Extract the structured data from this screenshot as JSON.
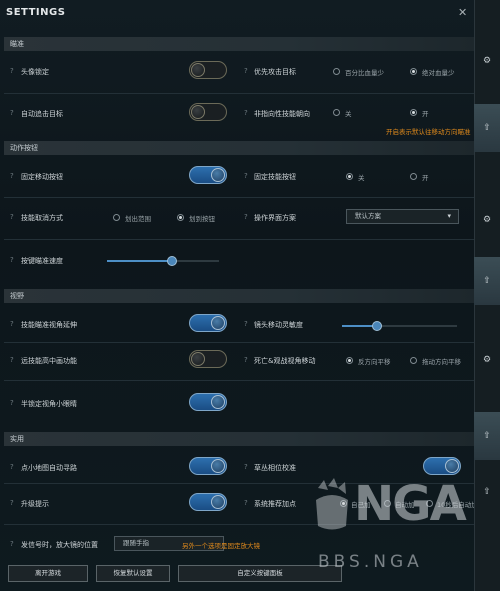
{
  "window": {
    "title": "SETTINGS",
    "close_glyph": "✕"
  },
  "sections": {
    "targeting": "瞄准",
    "action_buttons": "动作按钮",
    "view": "视野",
    "utility": "实用"
  },
  "settings": {
    "lock_portrait": {
      "label": "头像锁定",
      "state": "off"
    },
    "priority_target": {
      "label": "优先攻击目标",
      "options": [
        "百分比血量少",
        "绝对血量少"
      ],
      "selected": 1
    },
    "auto_chase": {
      "label": "自动追击目标",
      "state": "off"
    },
    "non_directional_skill": {
      "label": "非指向性技能朝向",
      "options": [
        "关",
        "开"
      ],
      "selected": 1
    },
    "non_directional_hint": "开启表示默认往移动方向瞄准",
    "fixed_move_button": {
      "label": "固定移动按钮",
      "state": "on"
    },
    "fixed_skill_button": {
      "label": "固定技能按钮",
      "options": [
        "关",
        "开"
      ],
      "selected": 0
    },
    "skill_cancel_mode": {
      "label": "技能取消方式",
      "options": [
        "划出范围",
        "划到按钮"
      ],
      "selected": 1
    },
    "control_scheme": {
      "label": "操作界面方案",
      "value": "默认方案"
    },
    "aim_speed": {
      "label": "按键瞄准速度",
      "value": 0.58
    },
    "aim_view_extend": {
      "label": "技能瞄准视角延伸",
      "state": "on"
    },
    "camera_sensitivity": {
      "label": "镜头移动灵敏度",
      "value": 0.3
    },
    "ranged_focus": {
      "label": "远技能高中画功能",
      "state": "off"
    },
    "death_camera": {
      "label": "死亡&观战视角移动",
      "options": [
        "反方向平移",
        "拖动方向平移"
      ],
      "selected": 0
    },
    "half_lock_minimap": {
      "label": "半锁定视角小眼睛",
      "state": "on"
    },
    "minimap_pathfind": {
      "label": "点小地图自动寻路",
      "state": "on"
    },
    "jungle_timer": {
      "label": "草丛相位校准",
      "state": "on"
    },
    "level_tip": {
      "label": "升级提示",
      "state": "on"
    },
    "auto_skill_point": {
      "label": "系统推荐加点",
      "options": [
        "自己加",
        "自动加",
        "10秒后自动加"
      ],
      "selected": 0
    },
    "signal_zoom": {
      "label": "发信号时，放大镜的位置",
      "value": "跟随手指",
      "hint": "另外一个选项是固定放大镜"
    }
  },
  "bottom_buttons": [
    "离开游戏",
    "恢复默认设置",
    "自定义按键面板"
  ],
  "sidebar_icons": [
    "gear-icon",
    "upload-icon",
    "gear-icon",
    "upload-icon",
    "gear-icon",
    "upload-icon",
    "upload-icon"
  ],
  "watermark": {
    "logo": "NGA",
    "url": "BBS.NGA"
  },
  "colors": {
    "accent_blue": "#2d6fae",
    "hint_orange": "#e08a1c"
  }
}
